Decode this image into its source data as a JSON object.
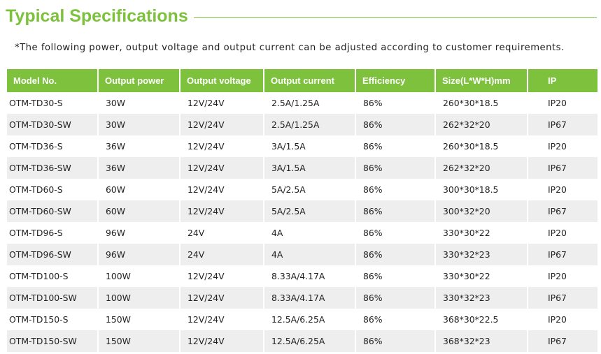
{
  "heading": {
    "title": "Typical Specifications"
  },
  "note": "*The following power, output voltage and output current can be adjusted according to customer requirements.",
  "colors": {
    "accent": "#7dc13d",
    "stripe": "#eeeeee",
    "header_text": "#ffffff"
  },
  "table": {
    "headers": [
      "Model No.",
      "Output power",
      "Output voltage",
      "Output current",
      "Efficiency",
      "Size(L*W*H)mm",
      "IP"
    ],
    "rows": [
      [
        "OTM-TD30-S",
        "30W",
        "12V/24V",
        "2.5A/1.25A",
        "86%",
        "260*30*18.5",
        "IP20"
      ],
      [
        "OTM-TD30-SW",
        "30W",
        "12V/24V",
        "2.5A/1.25A",
        "86%",
        "262*32*20",
        "IP67"
      ],
      [
        "OTM-TD36-S",
        "36W",
        "12V/24V",
        "3A/1.5A",
        "86%",
        "260*30*18.5",
        "IP20"
      ],
      [
        "OTM-TD36-SW",
        "36W",
        "12V/24V",
        "3A/1.5A",
        "86%",
        "262*32*20",
        "IP67"
      ],
      [
        "OTM-TD60-S",
        "60W",
        "12V/24V",
        "5A/2.5A",
        "86%",
        "300*30*18.5",
        "IP20"
      ],
      [
        "OTM-TD60-SW",
        "60W",
        "12V/24V",
        "5A/2.5A",
        "86%",
        "300*32*20",
        "IP67"
      ],
      [
        "OTM-TD96-S",
        "96W",
        "24V",
        "4A",
        "86%",
        "330*30*22",
        "IP20"
      ],
      [
        "OTM-TD96-SW",
        "96W",
        "24V",
        "4A",
        "86%",
        "330*32*23",
        "IP67"
      ],
      [
        "OTM-TD100-S",
        "100W",
        "12V/24V",
        "8.33A/4.17A",
        "86%",
        "330*30*22",
        "IP20"
      ],
      [
        "OTM-TD100-SW",
        "100W",
        "12V/24V",
        "8.33A/4.17A",
        "86%",
        "330*32*23",
        "IP67"
      ],
      [
        "OTM-TD150-S",
        "150W",
        "12V/24V",
        "12.5A/6.25A",
        "86%",
        "368*30*22.5",
        "IP20"
      ],
      [
        "OTM-TD150-SW",
        "150W",
        "12V/24V",
        "12.5A/6.25A",
        "86%",
        "368*32*23",
        "IP67"
      ]
    ]
  }
}
